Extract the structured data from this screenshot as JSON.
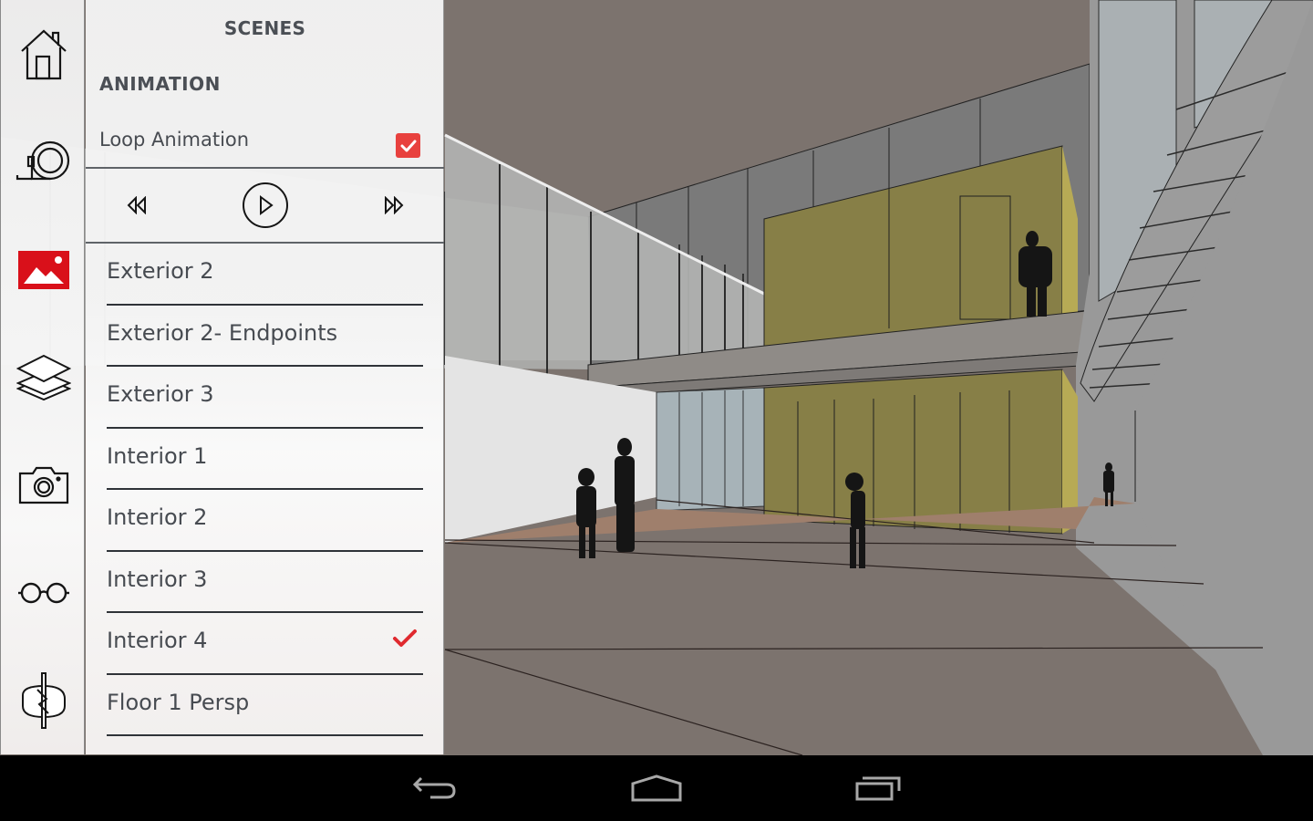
{
  "panel": {
    "title": "SCENES",
    "animation_heading": "ANIMATION",
    "loop_animation": {
      "label": "Loop Animation",
      "checked": true
    },
    "controls": {
      "previous": "rewind-icon",
      "play": "play-icon",
      "next": "fast-forward-icon"
    },
    "scenes": [
      {
        "label": "Exterior 2",
        "selected": false
      },
      {
        "label": "Exterior 2- Endpoints",
        "selected": false
      },
      {
        "label": "Exterior 3",
        "selected": false
      },
      {
        "label": "Interior 1",
        "selected": false
      },
      {
        "label": "Interior 2",
        "selected": false
      },
      {
        "label": "Interior 3",
        "selected": false
      },
      {
        "label": "Interior 4",
        "selected": true
      },
      {
        "label": "Floor 1 Persp",
        "selected": false
      }
    ]
  },
  "toolbar": {
    "items": [
      {
        "name": "home",
        "icon": "home-icon",
        "active": false
      },
      {
        "name": "measure",
        "icon": "tape-measure-icon",
        "active": false
      },
      {
        "name": "scenes",
        "icon": "image-icon",
        "active": true
      },
      {
        "name": "layers",
        "icon": "layers-icon",
        "active": false
      },
      {
        "name": "camera",
        "icon": "camera-icon",
        "active": false
      },
      {
        "name": "view",
        "icon": "glasses-icon",
        "active": false
      },
      {
        "name": "section",
        "icon": "section-rotate-icon",
        "active": false
      }
    ]
  },
  "navbar": {
    "back": "back-icon",
    "home": "home-nav-icon",
    "recents": "recent-apps-icon"
  },
  "colors": {
    "accent": "#e8413e",
    "active_icon": "#d9101a",
    "text": "#474b51",
    "ceiling": "#7c736e",
    "floor": "#9f7f6c",
    "yellow_box": "#877f47"
  }
}
